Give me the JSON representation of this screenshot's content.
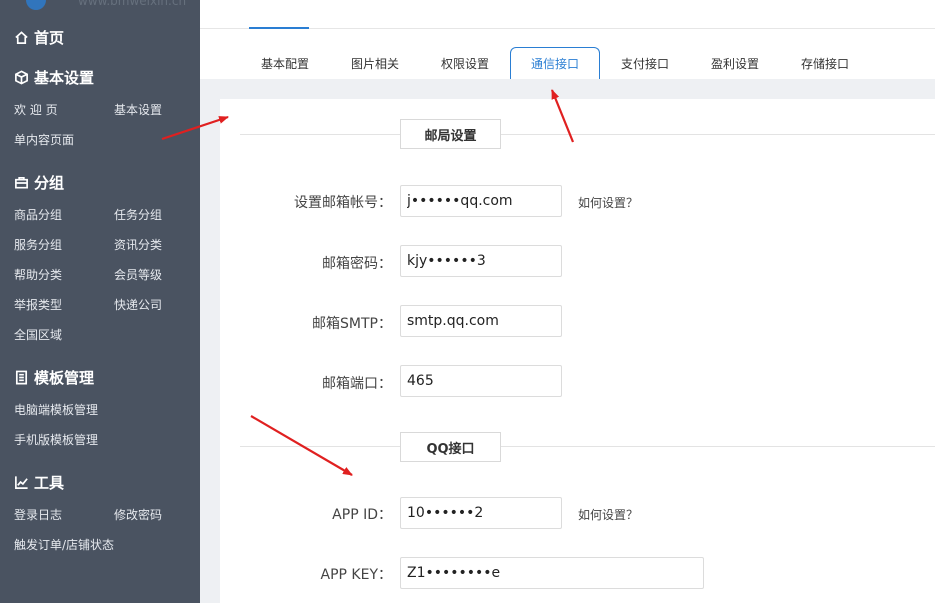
{
  "sidebar": {
    "brand": "www.bmweixin.cn",
    "home": "首页",
    "sections": {
      "basic": {
        "title": "基本设置",
        "items": [
          "欢 迎 页",
          "基本设置",
          "单内容页面"
        ]
      },
      "group": {
        "title": "分组",
        "items": [
          "商品分组",
          "任务分组",
          "服务分组",
          "资讯分类",
          "帮助分类",
          "会员等级",
          "举报类型",
          "快递公司",
          "全国区域"
        ]
      },
      "template": {
        "title": "模板管理",
        "items": [
          "电脑端模板管理",
          "手机版模板管理"
        ]
      },
      "tools": {
        "title": "工具",
        "items": [
          "登录日志",
          "修改密码",
          "触发订单/店铺状态"
        ]
      }
    }
  },
  "tabs": [
    "基本配置",
    "图片相关",
    "权限设置",
    "通信接口",
    "支付接口",
    "盈利设置",
    "存储接口"
  ],
  "active_tab": "通信接口",
  "mail": {
    "section_title": "邮局设置",
    "account_label": "设置邮箱帐号：",
    "account_value": "j••••••qq.com",
    "password_label": "邮箱密码：",
    "password_value": "kjy••••••3",
    "smtp_label": "邮箱SMTP：",
    "smtp_value": "smtp.qq.com",
    "port_label": "邮箱端口：",
    "port_value": "465",
    "help": "如何设置？"
  },
  "qq": {
    "section_title": "QQ接口",
    "appid_label": "APP ID：",
    "appid_value": "10••••••2",
    "appkey_label": "APP KEY：",
    "appkey_value": "Z1••••••••e",
    "help": "如何设置？"
  },
  "colors": {
    "sidebar": "#4a5361",
    "accent": "#2a7ed3",
    "arrow": "#e02020"
  }
}
